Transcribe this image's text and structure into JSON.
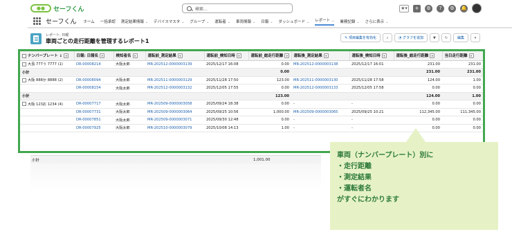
{
  "header": {
    "logo_text": "セーフくん",
    "logo_badge": "●●",
    "search_placeholder": "検索..."
  },
  "nav": {
    "app_name": "セーフくん",
    "items": [
      {
        "label": "ホーム",
        "chevron": ""
      },
      {
        "label": "一括承認",
        "chevron": ""
      },
      {
        "label": "測定結果情報",
        "chevron": "⌄"
      },
      {
        "label": "デバイスマスタ",
        "chevron": "⌄"
      },
      {
        "label": "グループ",
        "chevron": "⌄"
      },
      {
        "label": "運転者",
        "chevron": "⌄"
      },
      {
        "label": "車両情報",
        "chevron": "⌄"
      },
      {
        "label": "日報",
        "chevron": "⌄"
      },
      {
        "label": "ダッシュボード",
        "chevron": "⌄"
      },
      {
        "label": "レポート",
        "chevron": "⌄"
      },
      {
        "label": "業務記録",
        "chevron": "⌄"
      },
      {
        "label": "さらに表示",
        "chevron": "⌄"
      }
    ]
  },
  "page": {
    "subtitle": "レポート: 日報",
    "title": "車両ごとの走行距離を管理するレポート1",
    "btn_filter": "項目編集を有効化",
    "btn_graph": "グラフを追加",
    "btn_edit": "編集"
  },
  "table": {
    "columns": [
      "ナンバープレート ↓",
      "日報: 日報名",
      "検知者名",
      "運転前_測定結果",
      "運転前_検知日時",
      "運転前_総走行距離",
      "運転後_測定結果",
      "運転後_検知日時",
      "運転後_総走行距離",
      "当日走行距離"
    ],
    "rows": [
      {
        "type": "data",
        "cells": [
          "大島 777う 7777 (1)",
          "DR-00008214",
          "大阪太郎",
          "MR-202512-0000003139",
          "2025/12/17 16:08",
          "0.00",
          "MR-202512-0000003138",
          "2025/12/17 16:01",
          "231.00",
          "231.00"
        ],
        "checkbox": true
      },
      {
        "type": "sub",
        "cells": [
          "小計",
          "",
          "",
          "",
          "",
          "0.00",
          "",
          "",
          "231.00",
          "231.00"
        ]
      },
      {
        "type": "data",
        "cells": [
          "大阪 888か 8888 (2)",
          "DR-00008094",
          "大阪太郎",
          "MR-202511-0000003129",
          "2025/11/28 17:50",
          "123.00",
          "MR-202511-0000003130",
          "2025/11/28 17:58",
          "124.00",
          "1.00"
        ],
        "checkbox": true
      },
      {
        "type": "data",
        "cells": [
          "",
          "DR-00008154",
          "大阪太郎",
          "MR-202512-0000003132",
          "2025/12/05 17:55",
          "0.00",
          "MR-202512-0000003133",
          "2025/12/05 17:58",
          "0.00",
          "0.00"
        ]
      },
      {
        "type": "sub",
        "cells": [
          "小計",
          "",
          "",
          "",
          "",
          "123.00",
          "",
          "",
          "124.00",
          "1.00"
        ]
      },
      {
        "type": "data",
        "cells": [
          "大阪 123お 1234 (4)",
          "DR-00007717",
          "大阪太郎",
          "MR-202509-0000003058",
          "2025/09/24 18:38",
          "0.00",
          "-",
          "-",
          "0.00",
          "0.00"
        ],
        "checkbox": true
      },
      {
        "type": "data",
        "cells": [
          "",
          "DR-00007731",
          "大阪太郎",
          "MR-202509-0000003064",
          "2025/09/25 10:56",
          "1,000.00",
          "MR-202509-0000003065",
          "2025/09/25 10:21",
          "112,345.00",
          "111,345.00"
        ]
      },
      {
        "type": "data",
        "cells": [
          "",
          "DR-00007851",
          "大阪太郎",
          "MR-202509-0000003071",
          "2025/09/30 12:48",
          "0.00",
          "-",
          "-",
          "0.00",
          "0.00"
        ]
      },
      {
        "type": "data",
        "cells": [
          "",
          "DR-00007925",
          "大阪太郎",
          "MR-202510-0000003079",
          "2025/10/08 14:13",
          "1.00",
          "-",
          "-",
          "0.00",
          "0.00"
        ]
      }
    ]
  },
  "total": {
    "label": "小計",
    "value": "1,001.00"
  },
  "callout": {
    "lines": [
      "車両（ナンバープレート）別に",
      "・走行距離",
      "・測定結果",
      "・運転者名",
      "がすぐにわかります"
    ]
  },
  "colors": {
    "frame": "#42a74f",
    "callout_bg": "#e6f2c6",
    "callout_text": "#2e7a3b",
    "link": "#1b5fae"
  }
}
